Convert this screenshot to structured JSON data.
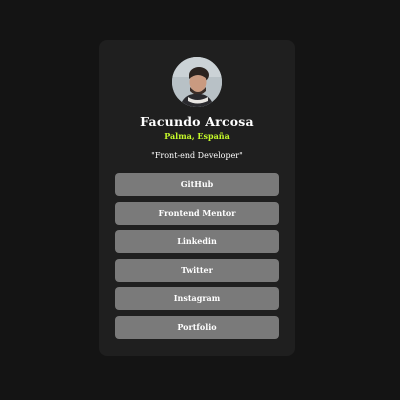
{
  "profile": {
    "name": "Facundo Arcosa",
    "location": "Palma, España",
    "bio": "\"Front-end Developer\""
  },
  "links": [
    {
      "label": "GitHub"
    },
    {
      "label": "Frontend Mentor"
    },
    {
      "label": "Linkedin"
    },
    {
      "label": "Twitter"
    },
    {
      "label": "Instagram"
    },
    {
      "label": "Portfolio"
    }
  ],
  "colors": {
    "background": "#141414",
    "card": "#1f1f1f",
    "accent": "#c4f82a",
    "button": "#7a7a7a",
    "text": "#ffffff"
  }
}
